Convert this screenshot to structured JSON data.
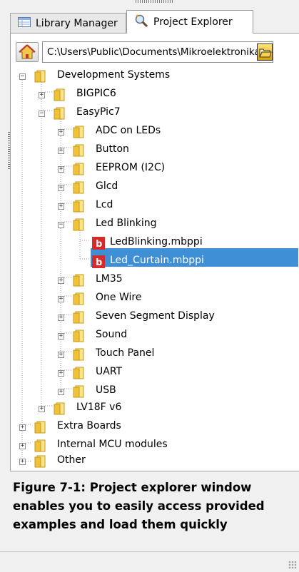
{
  "tabs": [
    {
      "label": "Library Manager",
      "icon": "library-grid-icon",
      "active": false
    },
    {
      "label": "Project Explorer",
      "icon": "magnifier-wand-icon",
      "active": true
    }
  ],
  "path": {
    "value": "C:\\Users\\Public\\Documents\\Mikroelektronika\\mikroC PRO for PIC\\Examples"
  },
  "tree": {
    "development_systems": "Development Systems",
    "bigpic6": "BIGPIC6",
    "easypic7": "EasyPic7",
    "adc": "ADC on LEDs",
    "button": "Button",
    "eeprom": "EEPROM (I2C)",
    "glcd": "Glcd",
    "lcd": "Lcd",
    "led_blinking": "Led Blinking",
    "file1": "LedBlinking.mbppi",
    "file2": "Led_Curtain.mbppi",
    "lm35": "LM35",
    "one_wire": "One Wire",
    "seven_segment": "Seven Segment Display",
    "sound": "Sound",
    "touch_panel": "Touch Panel",
    "uart": "UART",
    "usb": "USB",
    "lv18f": "LV18F v6",
    "extra_boards": "Extra Boards",
    "internal_mcu": "Internal MCU modules",
    "other": "Other"
  },
  "selected_item": "Led_Curtain.mbppi",
  "caption": {
    "line1": "Figure 7-1: Project explorer window",
    "line2": "enables you to easily access provided",
    "line3": "examples and load them quickly"
  },
  "colors": {
    "selection": "#3f8fd7",
    "folder": "#f0c23a",
    "file_icon": "#d62b2b"
  }
}
